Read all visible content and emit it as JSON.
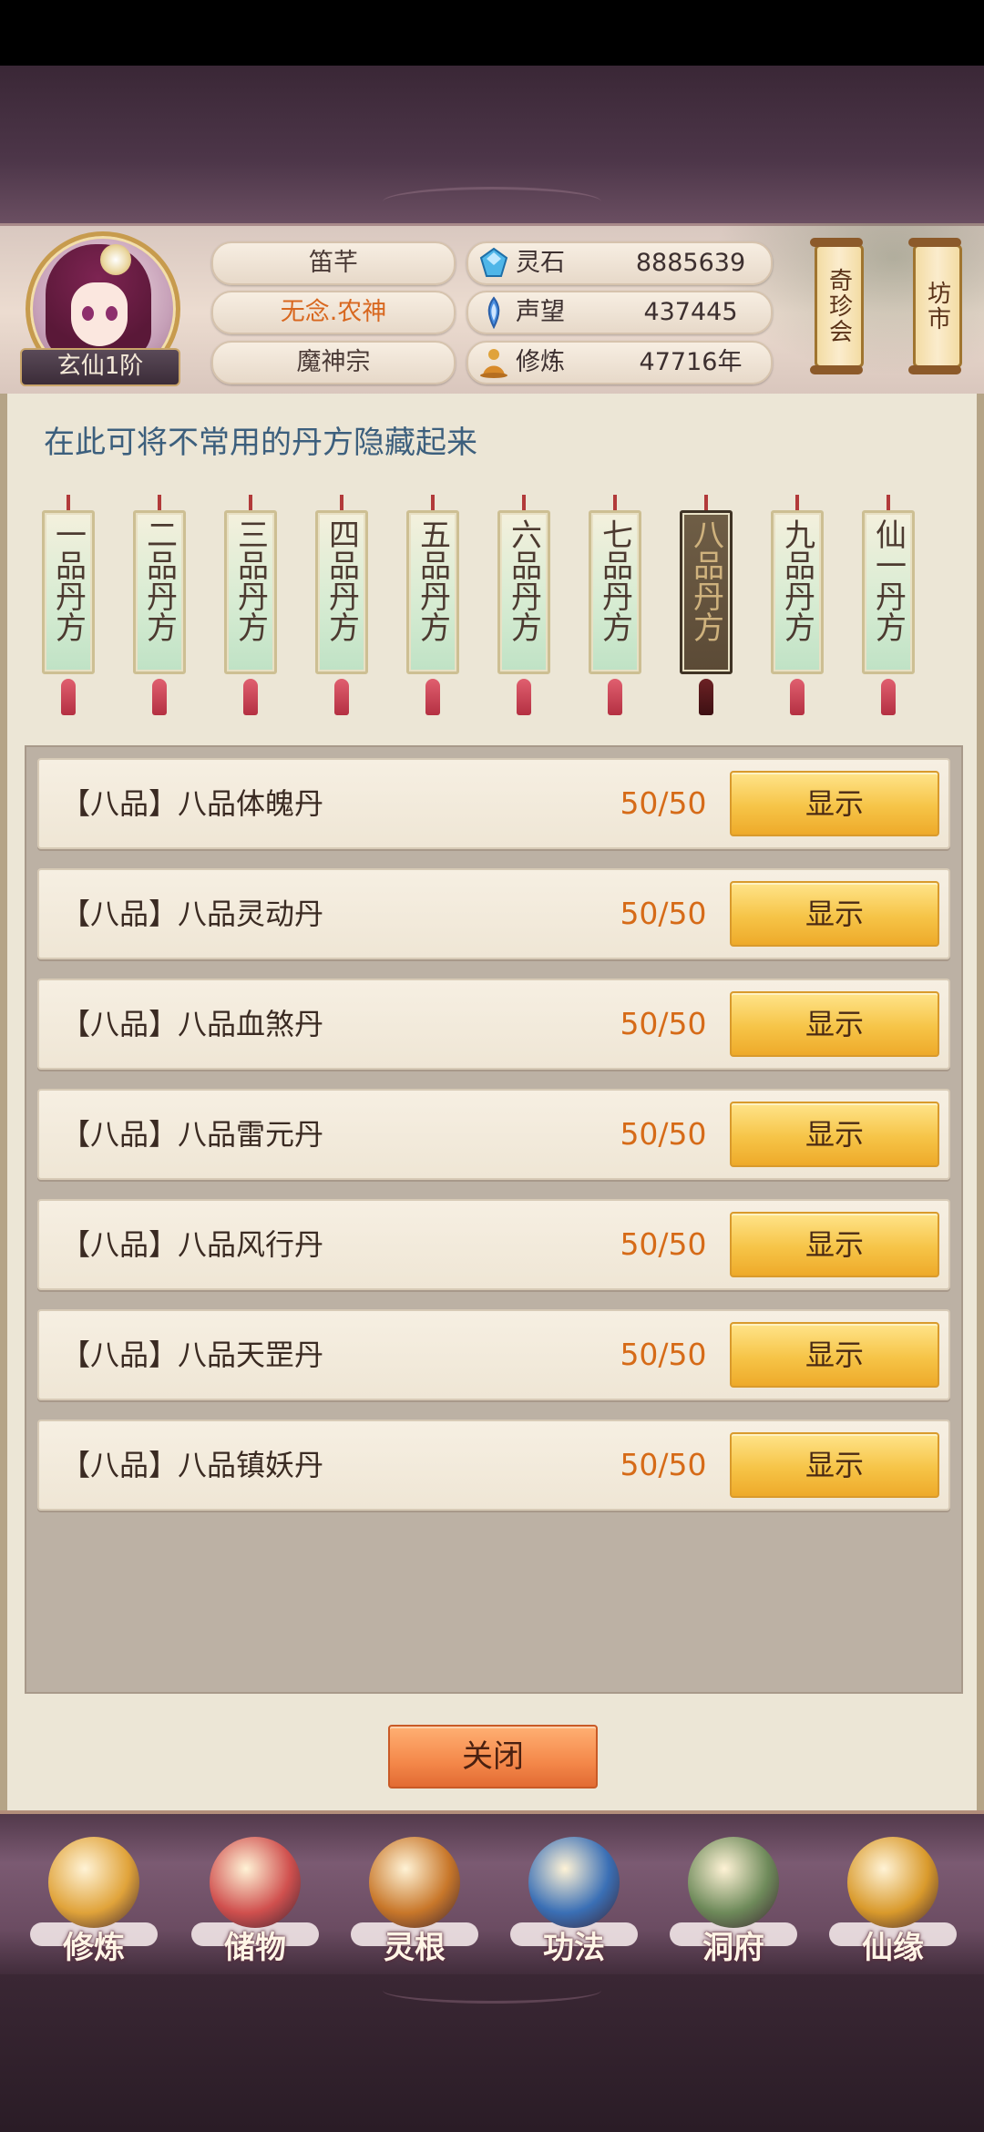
{
  "player": {
    "rank": "玄仙1阶",
    "name": "笛芊",
    "title": "无念.农神",
    "sect": "魔神宗"
  },
  "resources": [
    {
      "label": "灵石",
      "value": "8885639",
      "icon": "spirit-stone-icon"
    },
    {
      "label": "声望",
      "value": "437445",
      "icon": "reputation-icon"
    },
    {
      "label": "修炼",
      "value": "47716年",
      "icon": "cultivation-icon"
    }
  ],
  "side_buttons": {
    "qizhenhui": "奇珍会",
    "fangshi": "坊市"
  },
  "panel": {
    "hint": "在此可将不常用的丹方隐藏起来",
    "tabs": [
      "一品丹方",
      "二品丹方",
      "三品丹方",
      "四品丹方",
      "五品丹方",
      "六品丹方",
      "七品丹方",
      "八品丹方",
      "九品丹方",
      "仙一丹方"
    ],
    "active_tab_index": 7,
    "rows": [
      {
        "name": "【八品】八品体魄丹",
        "count": "50/50",
        "button": "显示"
      },
      {
        "name": "【八品】八品灵动丹",
        "count": "50/50",
        "button": "显示"
      },
      {
        "name": "【八品】八品血煞丹",
        "count": "50/50",
        "button": "显示"
      },
      {
        "name": "【八品】八品雷元丹",
        "count": "50/50",
        "button": "显示"
      },
      {
        "name": "【八品】八品风行丹",
        "count": "50/50",
        "button": "显示"
      },
      {
        "name": "【八品】八品天罡丹",
        "count": "50/50",
        "button": "显示"
      },
      {
        "name": "【八品】八品镇妖丹",
        "count": "50/50",
        "button": "显示"
      }
    ],
    "close": "关闭"
  },
  "nav": [
    {
      "label": "修炼",
      "icon": "meditating-figure-icon",
      "color": "#e0a33a"
    },
    {
      "label": "储物",
      "icon": "storage-bag-icon",
      "color": "#d0504e"
    },
    {
      "label": "灵根",
      "icon": "spirit-root-swirl-icon",
      "color": "#c8772a"
    },
    {
      "label": "功法",
      "icon": "scroll-book-icon",
      "color": "#3a6fb5"
    },
    {
      "label": "洞府",
      "icon": "cave-dwelling-icon",
      "color": "#6e8a5a"
    },
    {
      "label": "仙缘",
      "icon": "gourd-icon",
      "color": "#d99a2c"
    }
  ]
}
